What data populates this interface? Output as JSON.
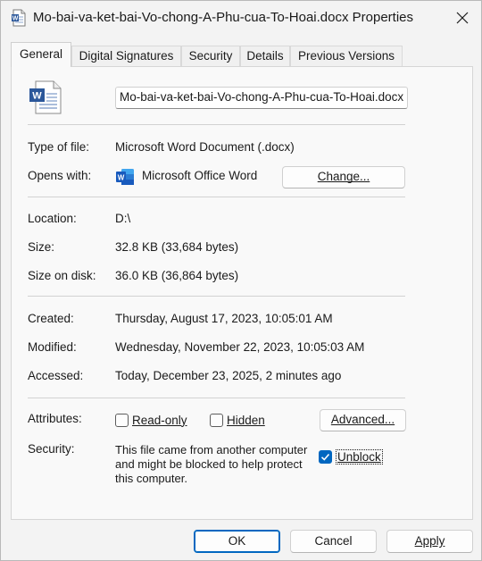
{
  "window": {
    "title": "Mo-bai-va-ket-bai-Vo-chong-A-Phu-cua-To-Hoai.docx Properties",
    "close_glyph": "✕"
  },
  "tabs": [
    {
      "label": "General",
      "active": true
    },
    {
      "label": "Digital Signatures",
      "active": false
    },
    {
      "label": "Security",
      "active": false
    },
    {
      "label": "Details",
      "active": false
    },
    {
      "label": "Previous Versions",
      "active": false
    }
  ],
  "general": {
    "filename": "Mo-bai-va-ket-bai-Vo-chong-A-Phu-cua-To-Hoai.docx",
    "type_label": "Type of file:",
    "type_value": "Microsoft Word Document (.docx)",
    "opens_label": "Opens with:",
    "opens_value": "Microsoft Office Word",
    "change_button": "Change...",
    "location_label": "Location:",
    "location_value": "D:\\",
    "size_label": "Size:",
    "size_value": "32.8 KB (33,684 bytes)",
    "size_on_disk_label": "Size on disk:",
    "size_on_disk_value": "36.0 KB (36,864 bytes)",
    "created_label": "Created:",
    "created_value": "Thursday, August 17, 2023, 10:05:01 AM",
    "modified_label": "Modified:",
    "modified_value": "Wednesday, November 22, 2023, 10:05:03 AM",
    "accessed_label": "Accessed:",
    "accessed_value": "Today, December 23, 2025, 2 minutes ago",
    "attributes_label": "Attributes:",
    "readonly_label": "Read-only",
    "readonly_checked": false,
    "hidden_label": "Hidden",
    "hidden_checked": false,
    "advanced_button": "Advanced...",
    "security_label": "Security:",
    "security_text": "This file came from another computer and might be blocked to help protect this computer.",
    "unblock_label": "Unblock",
    "unblock_checked": true
  },
  "footer": {
    "ok": "OK",
    "cancel": "Cancel",
    "apply": "Apply"
  },
  "colors": {
    "accent": "#0067c0",
    "word_blue": "#2b579a"
  }
}
